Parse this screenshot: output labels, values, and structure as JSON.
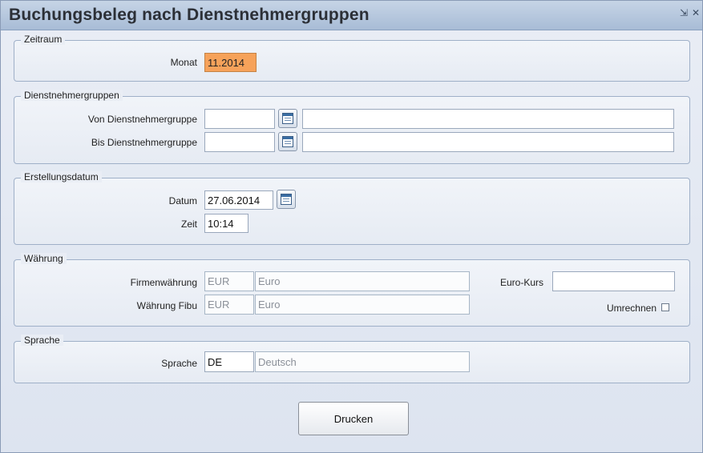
{
  "window": {
    "title": "Buchungsbeleg nach Dienstnehmergruppen",
    "minimize_glyph": "⇲",
    "close_glyph": "✕"
  },
  "zeitraum": {
    "legend": "Zeitraum",
    "monat_label": "Monat",
    "monat_value": "11.2014"
  },
  "dienstnehmergruppen": {
    "legend": "Dienstnehmergruppen",
    "von_label": "Von Dienstnehmergruppe",
    "von_value": "",
    "von_desc": "",
    "bis_label": "Bis Dienstnehmergruppe",
    "bis_value": "",
    "bis_desc": ""
  },
  "erstellungsdatum": {
    "legend": "Erstellungsdatum",
    "datum_label": "Datum",
    "datum_value": "27.06.2014",
    "zeit_label": "Zeit",
    "zeit_value": "10:14"
  },
  "waehrung": {
    "legend": "Währung",
    "firmenwaehrung_label": "Firmenwährung",
    "firmenwaehrung_code": "EUR",
    "firmenwaehrung_name": "Euro",
    "fibu_label": "Währung Fibu",
    "fibu_code": "EUR",
    "fibu_name": "Euro",
    "eurokurs_label": "Euro-Kurs",
    "eurokurs_value": "",
    "umrechnen_label": "Umrechnen",
    "umrechnen_checked": false
  },
  "sprache": {
    "legend": "Sprache",
    "label": "Sprache",
    "code": "DE",
    "name": "Deutsch"
  },
  "actions": {
    "drucken_label": "Drucken"
  },
  "icons": {
    "picker": "list-picker-icon",
    "minimize": "minimize-icon",
    "close": "close-icon"
  },
  "colors": {
    "highlight_field": "#f6a25a",
    "titlebar": "#b7c8de"
  }
}
